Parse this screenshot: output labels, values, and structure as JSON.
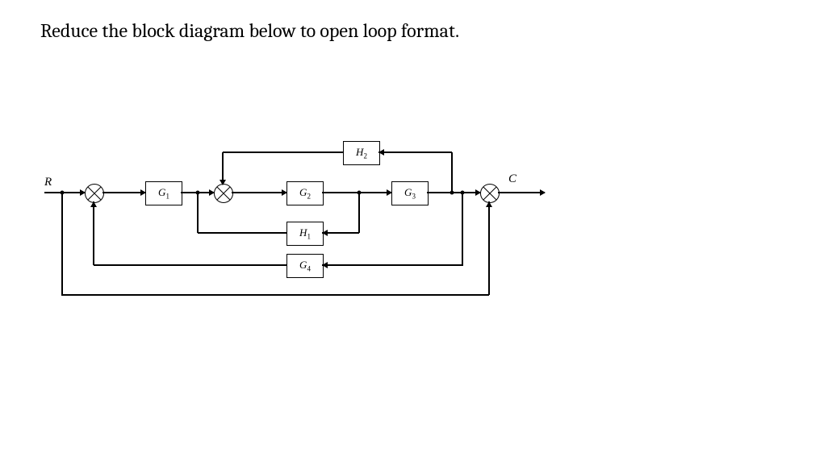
{
  "instruction": "Reduce the block diagram below to open loop format.",
  "labels": {
    "input": "R",
    "output": "C"
  },
  "blocks": {
    "g1": {
      "base": "G",
      "sub": "1"
    },
    "g2": {
      "base": "G",
      "sub": "2"
    },
    "g3": {
      "base": "G",
      "sub": "3"
    },
    "g4": {
      "base": "G",
      "sub": "4"
    },
    "h1": {
      "base": "H",
      "sub": "1"
    },
    "h2": {
      "base": "H",
      "sub": "2"
    }
  }
}
